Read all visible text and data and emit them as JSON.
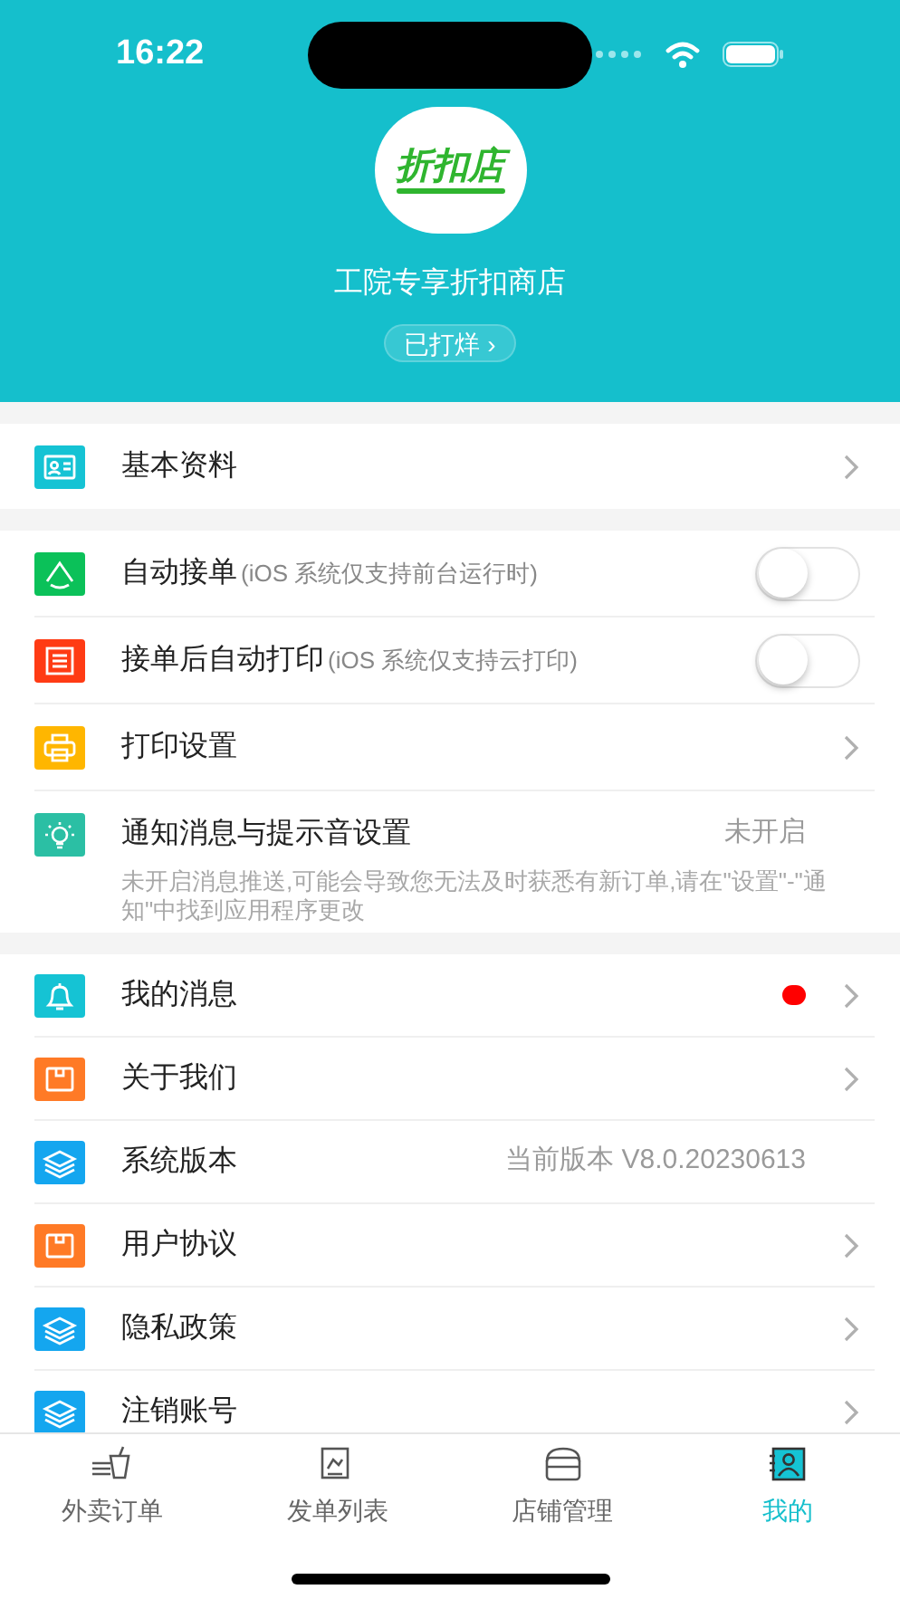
{
  "status_bar": {
    "time": "16:22"
  },
  "header": {
    "logo_text": "折扣店",
    "shop_name": "工院专享折扣商店",
    "status_pill": "已打烊 ›"
  },
  "sections": [
    {
      "items": [
        {
          "kind": "link",
          "label": "基本资料"
        }
      ]
    },
    {
      "items": [
        {
          "kind": "toggle",
          "label": "自动接单",
          "hint": "(iOS 系统仅支持前台运行时)",
          "on": false
        },
        {
          "kind": "toggle",
          "label": "接单后自动打印",
          "hint": "(iOS 系统仅支持云打印)",
          "on": false
        },
        {
          "kind": "link",
          "label": "打印设置"
        },
        {
          "kind": "value",
          "label": "通知消息与提示音设置",
          "value": "未开启",
          "note": "未开启消息推送,可能会导致您无法及时获悉有新订单,请在\"设置\"-\"通知\"中找到应用程序更改"
        }
      ]
    },
    {
      "items": [
        {
          "kind": "badge",
          "label": "我的消息",
          "color": "#ff0000"
        },
        {
          "kind": "link",
          "label": "关于我们"
        },
        {
          "kind": "value",
          "label": "系统版本",
          "value": "当前版本 V8.0.20230613"
        },
        {
          "kind": "link",
          "label": "用户协议"
        },
        {
          "kind": "link",
          "label": "隐私政策"
        },
        {
          "kind": "link",
          "label": "注销账号"
        }
      ]
    }
  ],
  "tab_bar": [
    {
      "label": "外卖订单",
      "selected": false
    },
    {
      "label": "发单列表",
      "selected": false
    },
    {
      "label": "店铺管理",
      "selected": false
    },
    {
      "label": "我的",
      "selected": true
    }
  ]
}
